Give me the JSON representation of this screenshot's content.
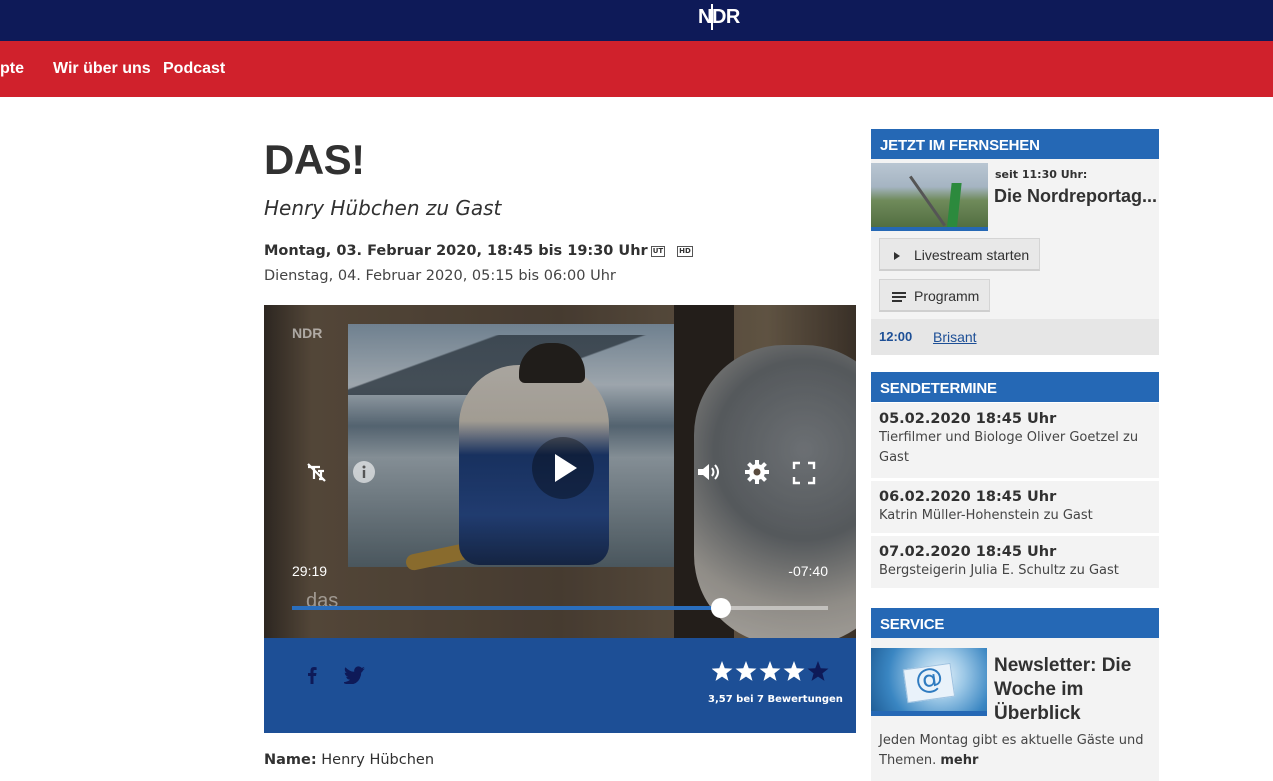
{
  "header": {
    "logo": "NDR",
    "nav": [
      "pte",
      "Wir über uns",
      "Podcast"
    ]
  },
  "main": {
    "title": "DAS!",
    "subtitle": "Henry Hübchen zu Gast",
    "airing1": "Montag, 03. Februar 2020, 18:45 bis 19:30 Uhr",
    "badge_ut": "UT",
    "badge_hd": "HD",
    "airing2": "Dienstag, 04. Februar 2020, 05:15 bis 06:00 Uhr",
    "video": {
      "watermark": "NDR",
      "show_logo": "das",
      "elapsed": "29:19",
      "remaining": "-07:40",
      "progress": 0.8
    },
    "share": {
      "rating_text": "3,57 bei 7 Bewertungen",
      "rating_value": 3.57,
      "rating_max": 5
    },
    "name_label": "Name:",
    "name_value": "Henry Hübchen"
  },
  "sidebar": {
    "tv": {
      "heading": "JETZT IM FERNSEHEN",
      "since": "seit 11:30 Uhr:",
      "show": "Die Nordreportag...",
      "livestream_label": "Livestream starten",
      "programm_label": "Programm",
      "next_time": "12:00",
      "next_show": "Brisant"
    },
    "termine": {
      "heading": "SENDETERMINE",
      "items": [
        {
          "date": "05.02.2020 18:45 Uhr",
          "desc": "Tierfilmer und Biologe Oliver Goetzel zu Gast"
        },
        {
          "date": "06.02.2020 18:45 Uhr",
          "desc": "Katrin Müller-Hohenstein zu Gast"
        },
        {
          "date": "07.02.2020 18:45 Uhr",
          "desc": "Bergsteigerin Julia E. Schultz zu Gast"
        }
      ]
    },
    "service": {
      "heading": "SERVICE",
      "title": "Newsletter: Die Woche im Überblick",
      "text": "Jeden Montag gibt es aktuelle Gäste und Themen.",
      "more": "mehr"
    }
  },
  "colors": {
    "topbar": "#0e1a58",
    "navbar": "#d0212c",
    "accent_blue": "#2568b5",
    "share_blue": "#1d4f96"
  }
}
